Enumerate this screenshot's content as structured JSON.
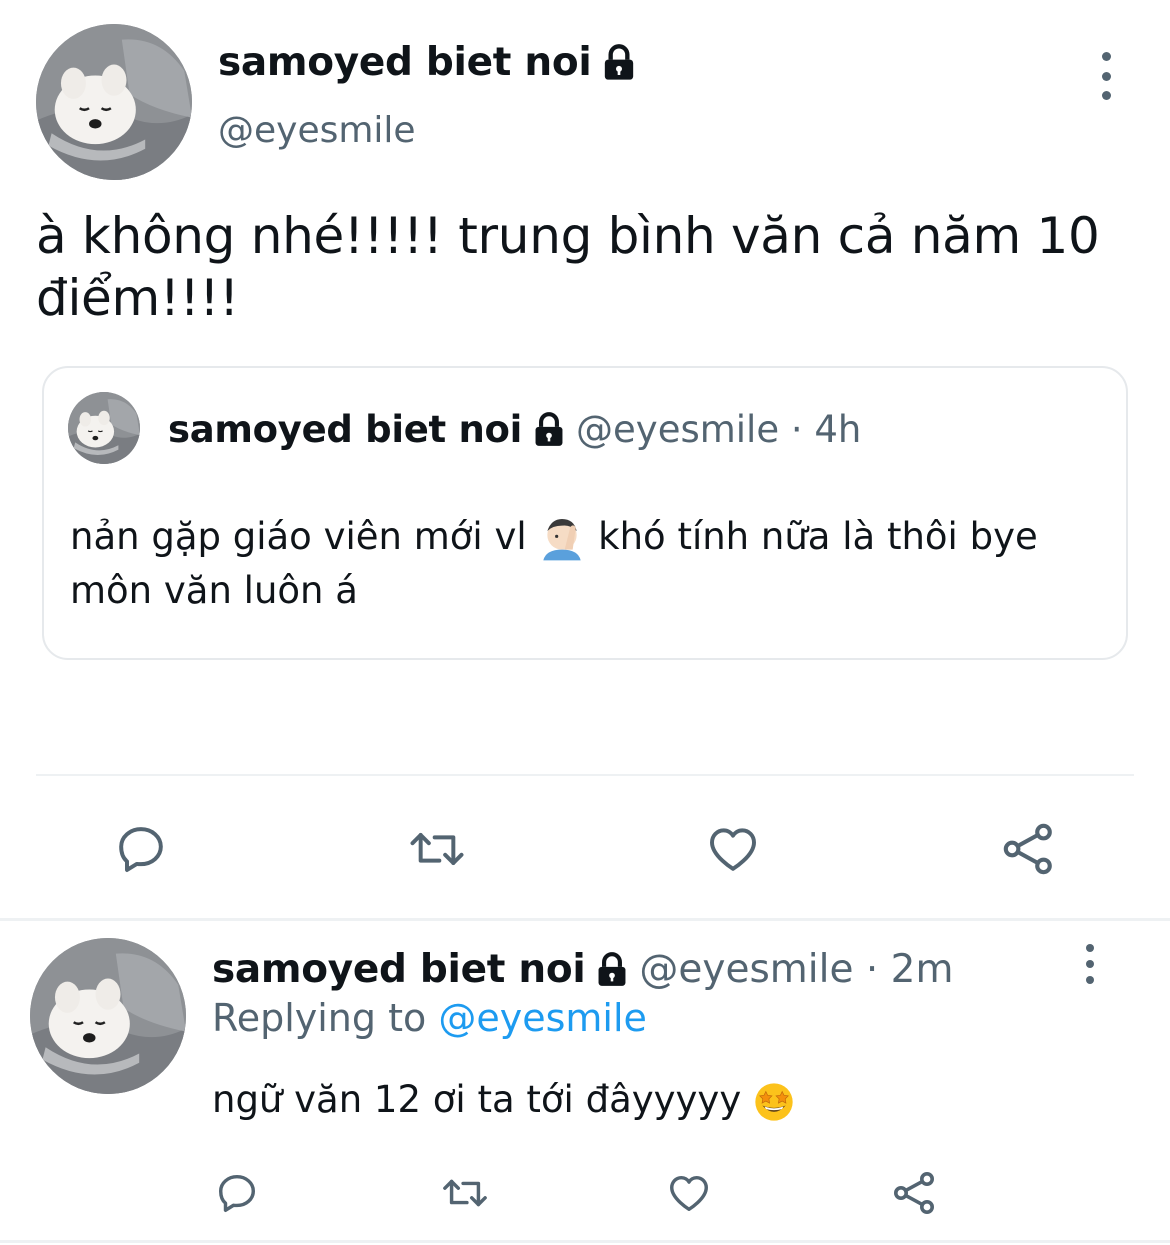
{
  "main_tweet": {
    "display_name": "samoyed biet noi",
    "handle": "@eyesmile",
    "text_line1": "à không nhé!!!!! trung bình văn cả năm 10",
    "text_line2": "điểm!!!!",
    "more_icon": "more-vertical-icon",
    "lock_icon": "lock-icon"
  },
  "quoted_tweet": {
    "display_name": "samoyed biet noi",
    "meta": "@eyesmile · 4h",
    "text_line1_part1": "nản gặp giáo viên mới vl",
    "text_line1_part2": "khó tính nữa là thôi bye",
    "text_line2": "môn văn luôn á",
    "emoji": "face-palm-emoji"
  },
  "actions": [
    {
      "name": "reply",
      "icon": "reply-icon"
    },
    {
      "name": "retweet",
      "icon": "retweet-icon"
    },
    {
      "name": "like",
      "icon": "heart-icon"
    },
    {
      "name": "share",
      "icon": "share-icon"
    }
  ],
  "reply_tweet": {
    "display_name": "samoyed biet noi",
    "meta": "@eyesmile · 2m",
    "replying_prefix": "Replying to",
    "replying_handle": "@eyesmile",
    "text": "ngữ văn 12 ơi ta tới đâyyyyy",
    "emoji": "star-struck-emoji"
  },
  "colors": {
    "text_primary": "#0f1419",
    "text_secondary": "#536471",
    "link": "#1d9bf0",
    "divider": "#eef1f3",
    "border": "#e6e9ec"
  }
}
